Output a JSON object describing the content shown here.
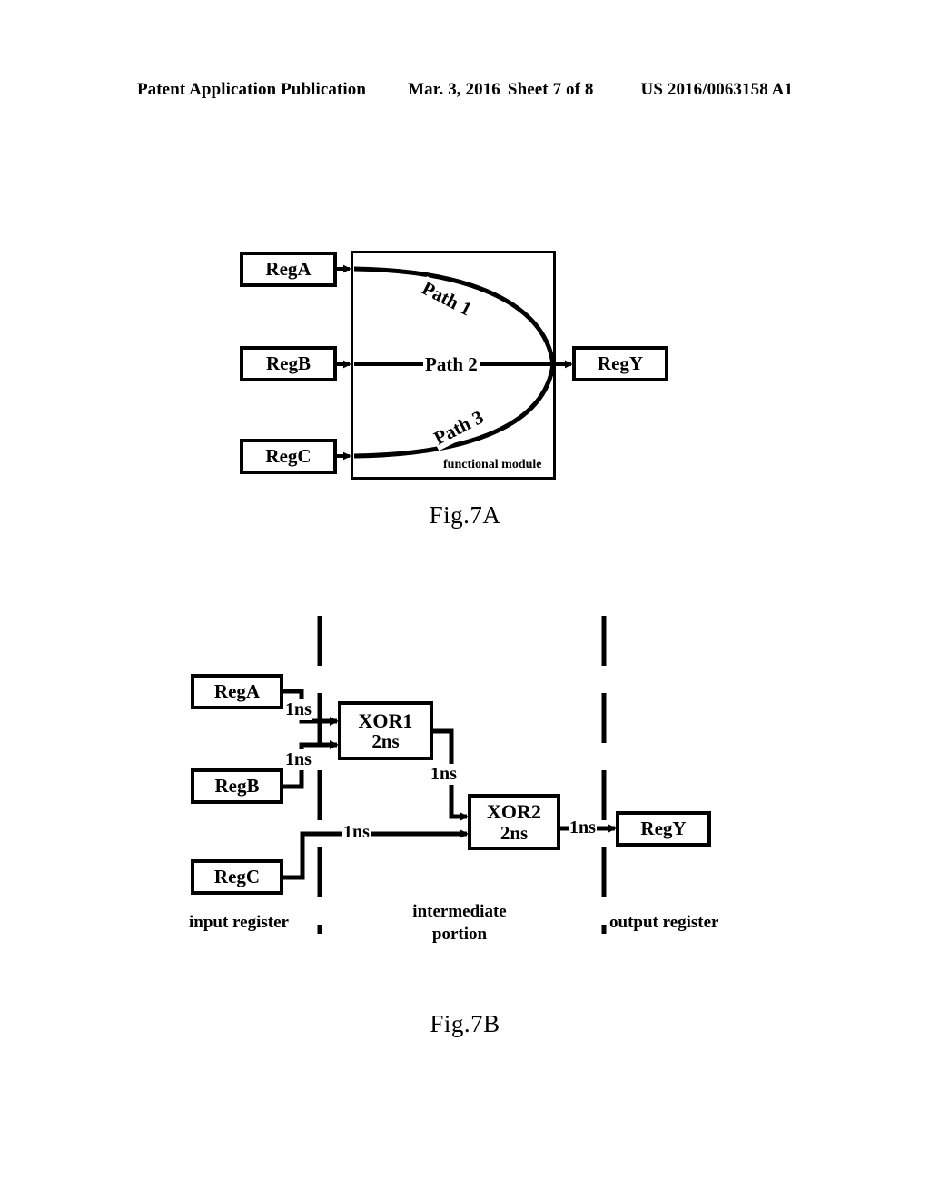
{
  "header": {
    "publication": "Patent Application Publication",
    "date": "Mar. 3, 2016",
    "sheet": "Sheet 7 of 8",
    "document_number": "US 2016/0063158 A1"
  },
  "figures": [
    {
      "caption": "Fig.7A",
      "module_label": "functional module",
      "inputs": [
        {
          "label": "RegA"
        },
        {
          "label": "RegB"
        },
        {
          "label": "RegC"
        }
      ],
      "output": {
        "label": "RegY"
      },
      "paths": [
        {
          "label": "Path 1"
        },
        {
          "label": "Path 2"
        },
        {
          "label": "Path 3"
        }
      ]
    },
    {
      "caption": "Fig.7B",
      "inputs": [
        {
          "label": "RegA"
        },
        {
          "label": "RegB"
        },
        {
          "label": "RegC"
        }
      ],
      "gates": [
        {
          "name": "XOR1",
          "delay": "2ns"
        },
        {
          "name": "XOR2",
          "delay": "2ns"
        }
      ],
      "output": {
        "label": "RegY"
      },
      "delays": [
        {
          "id": "rega-to-xor1",
          "label": "1ns"
        },
        {
          "id": "regb-to-xor1",
          "label": "1ns"
        },
        {
          "id": "xor1-to-xor2",
          "label": "1ns"
        },
        {
          "id": "regc-to-xor2",
          "label": "1ns"
        },
        {
          "id": "xor2-to-regy",
          "label": "1ns"
        }
      ],
      "zones": [
        {
          "id": "input-register",
          "label": "input register"
        },
        {
          "id": "intermediate-portion",
          "label": "intermediate\nportion"
        },
        {
          "id": "output-register",
          "label": "output register"
        }
      ]
    }
  ],
  "colors": {
    "ink": "#000000",
    "page": "#ffffff"
  }
}
